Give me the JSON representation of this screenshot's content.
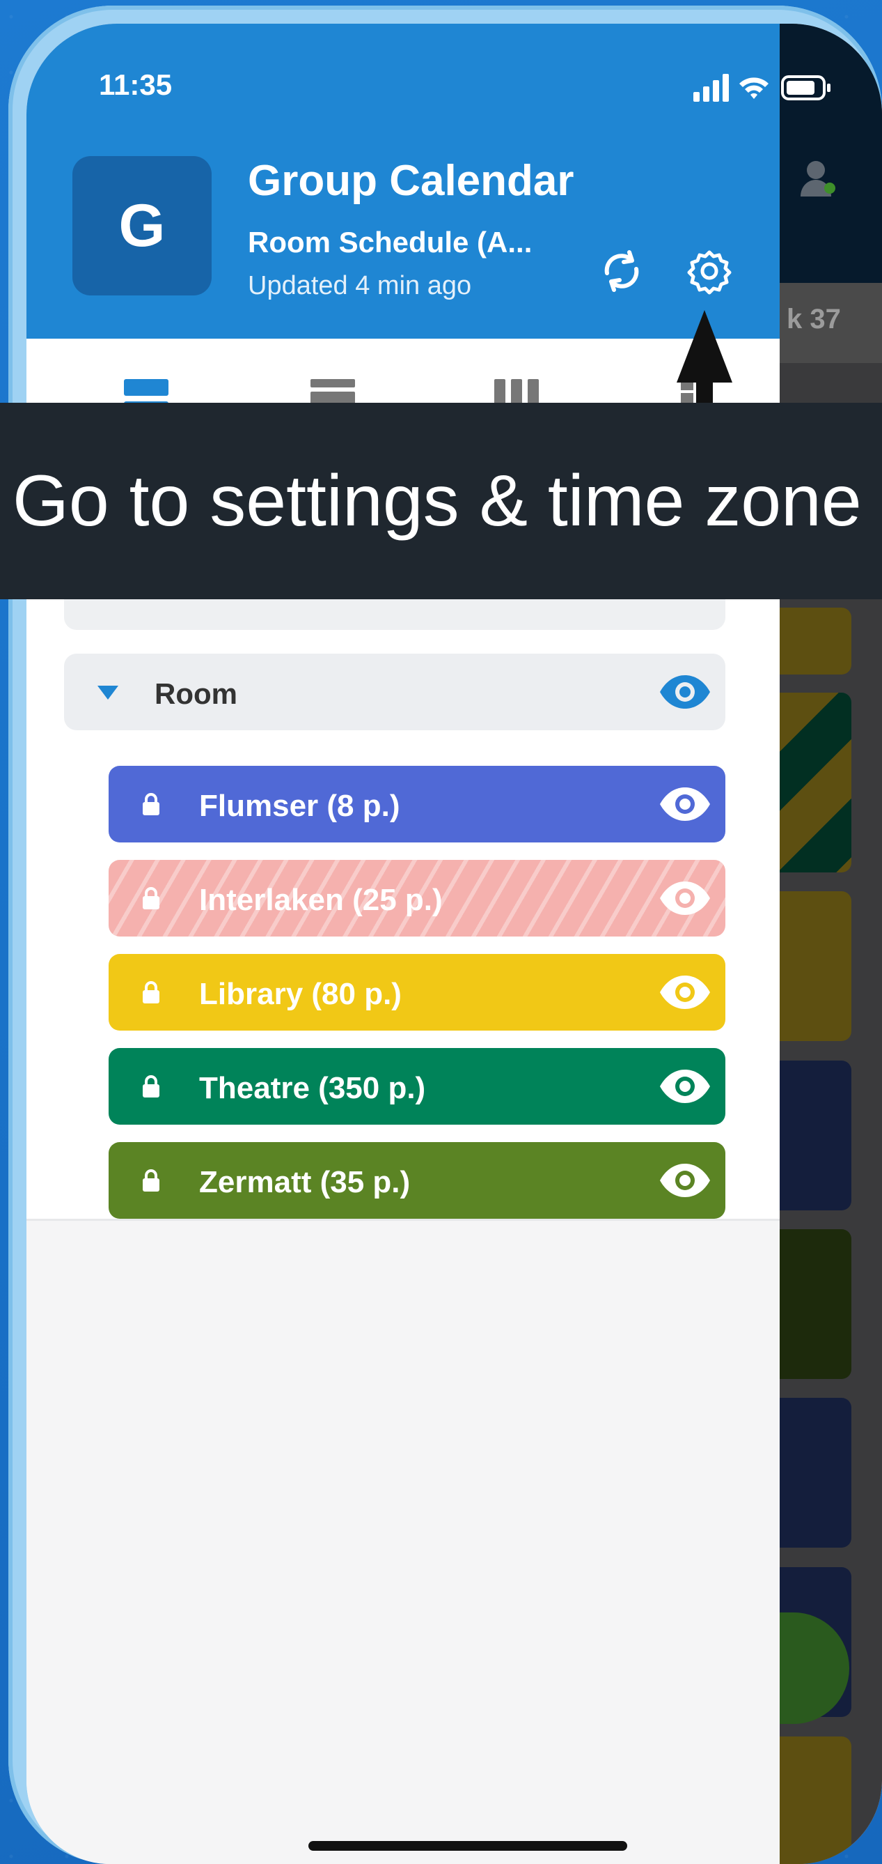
{
  "status_bar": {
    "time": "11:35"
  },
  "app": {
    "icon_letter": "G",
    "title": "Group Calendar",
    "subtitle": "Room Schedule (A...",
    "updated": "Updated 4 min ago"
  },
  "calendar_behind": {
    "week_label": "k 37"
  },
  "tooltip": {
    "text": "Go to settings & time zone"
  },
  "room_group": {
    "label": "Room"
  },
  "rooms": [
    {
      "label": "Flumser (8 p.)",
      "color": "#5069d6",
      "hidden": false
    },
    {
      "label": "Interlaken (25 p.)",
      "color": "#f5b1ae",
      "hidden": true
    },
    {
      "label": "Library (80 p.)",
      "color": "#f1c816",
      "hidden": false
    },
    {
      "label": "Theatre (350 p.)",
      "color": "#008359",
      "hidden": false
    },
    {
      "label": "Zermatt (35 p.)",
      "color": "#5b8424",
      "hidden": false
    }
  ],
  "colors": {
    "header": "#1f86d3",
    "accent": "#1f86d3",
    "tooltip_bg": "#1f272f"
  },
  "icons": [
    "sync-icon",
    "gear-icon",
    "lock-icon",
    "eye-icon",
    "caret-down-icon"
  ]
}
